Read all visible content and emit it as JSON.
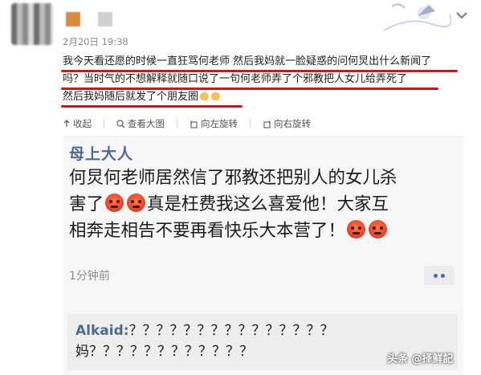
{
  "post": {
    "date": "2月20日 19:38",
    "lines": [
      "我今天看还愿的时候一直狂骂何老师 然后我妈就一脸疑惑的问何炅出什么新闻了",
      "吗？当时气的不想解释就随口说了一句何老师弄了个邪教把人女儿给弄死了",
      "然后我妈随后就发了个朋友圈"
    ],
    "highlight_color": "#d4141b"
  },
  "actions": {
    "collapse": "收起",
    "view_large": "查看大图",
    "rotate_left": "向左旋转",
    "rotate_right": "向右旋转"
  },
  "moment": {
    "author": "母上大人",
    "lines": [
      "何炅何老师居然信了邪教还把别人的女儿杀",
      [
        "害了",
        "真是枉费我这么喜爱他！大家互"
      ],
      "相奔走相告不要再看快乐大本营了！"
    ],
    "time": "1分钟前",
    "comment": {
      "name": "Alkaid:",
      "line1": "？？？？？？？？？？？？？？？",
      "line2": "妈？？？？？？？？？？？？"
    }
  },
  "watermark": "头条 @择鲜記"
}
